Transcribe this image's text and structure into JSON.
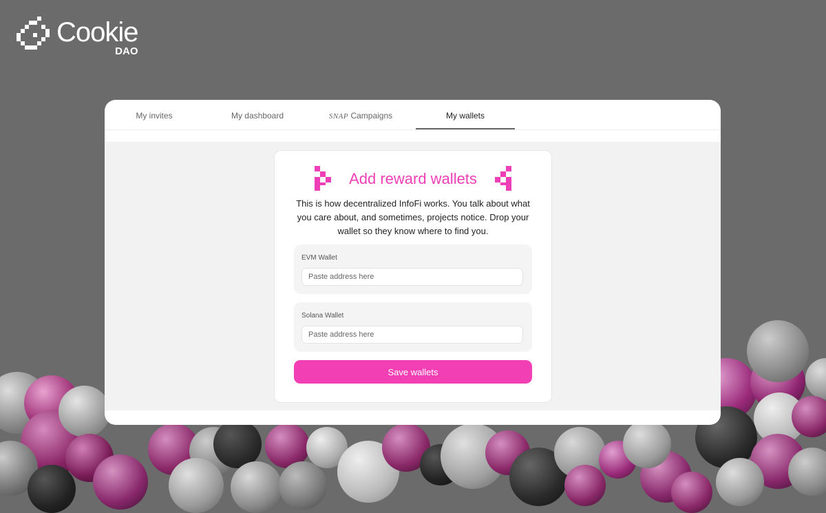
{
  "brand": {
    "name": "Cookie",
    "sub": "DAO",
    "accent": "#f23fb4"
  },
  "tabs": [
    {
      "label": "My invites"
    },
    {
      "label": "My dashboard"
    },
    {
      "label": "Campaigns",
      "prefix": "SNAP"
    },
    {
      "label": "My wallets",
      "active": true
    }
  ],
  "wallets": {
    "title": "Add reward wallets",
    "description": "This is how decentralized InfoFi works. You talk about what you care about, and sometimes, projects notice. Drop your wallet so they know where to find you.",
    "evm": {
      "label": "EVM Wallet",
      "placeholder": "Paste address here",
      "value": ""
    },
    "solana": {
      "label": "Solana Wallet",
      "placeholder": "Paste address here",
      "value": ""
    },
    "save_label": "Save wallets"
  },
  "icons": [
    "cookie-logo-icon",
    "pixel-decoration-left-icon",
    "pixel-decoration-right-icon"
  ]
}
